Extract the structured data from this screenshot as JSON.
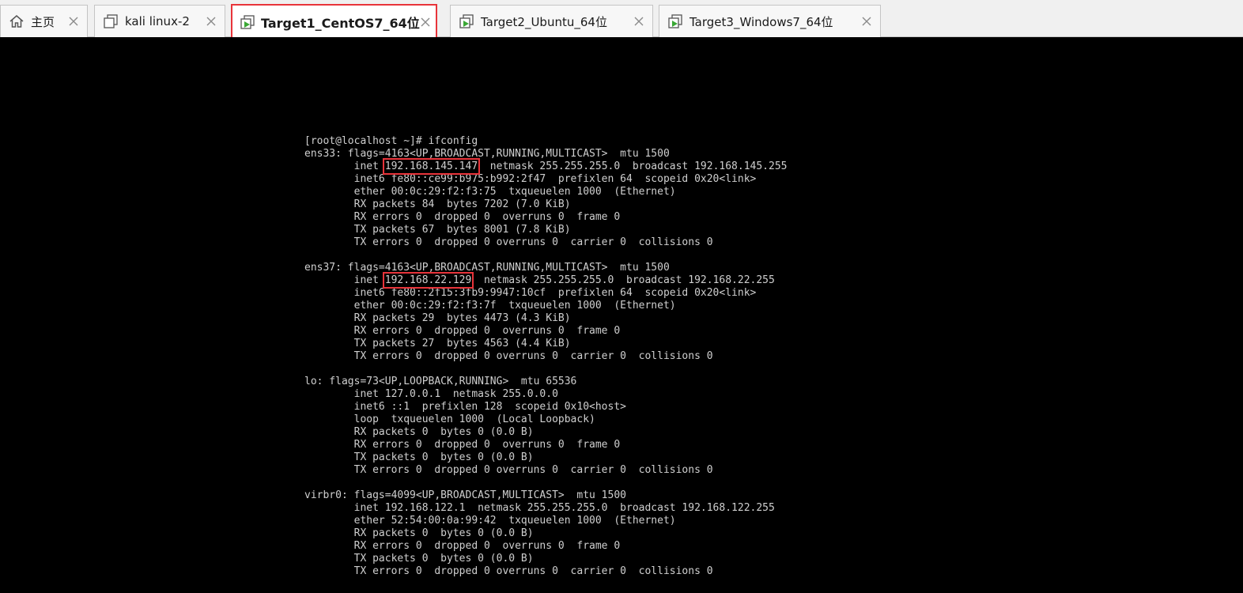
{
  "tabs": [
    {
      "label": "主页",
      "icon": "home-icon"
    },
    {
      "label": "kali linux-2",
      "icon": "vm-icon"
    },
    {
      "label": "Target1_CentOS7_64位",
      "icon": "vm-running-icon",
      "active": true
    },
    {
      "label": "Target2_Ubuntu_64位",
      "icon": "vm-running-icon"
    },
    {
      "label": "Target3_Windows7_64位",
      "icon": "vm-running-icon"
    }
  ],
  "colors": {
    "highlight": "#e8343a",
    "running": "#3aa835",
    "terminal_bg": "#000000",
    "terminal_fg": "#cfcfcf"
  },
  "terminal": {
    "lines": [
      "[root@localhost ~]# ifconfig",
      "ens33: flags=4163<UP,BROADCAST,RUNNING,MULTICAST>  mtu 1500",
      {
        "pre": "        inet ",
        "hl": "192.168.145.147",
        "post": "  netmask 255.255.255.0  broadcast 192.168.145.255"
      },
      "        inet6 fe80::ce99:b975:b992:2f47  prefixlen 64  scopeid 0x20<link>",
      "        ether 00:0c:29:f2:f3:75  txqueuelen 1000  (Ethernet)",
      "        RX packets 84  bytes 7202 (7.0 KiB)",
      "        RX errors 0  dropped 0  overruns 0  frame 0",
      "        TX packets 67  bytes 8001 (7.8 KiB)",
      "        TX errors 0  dropped 0 overruns 0  carrier 0  collisions 0",
      "",
      "ens37: flags=4163<UP,BROADCAST,RUNNING,MULTICAST>  mtu 1500",
      {
        "pre": "        inet ",
        "hl": "192.168.22.129",
        "post": "  netmask 255.255.255.0  broadcast 192.168.22.255"
      },
      "        inet6 fe80::2f15:3fb9:9947:10cf  prefixlen 64  scopeid 0x20<link>",
      "        ether 00:0c:29:f2:f3:7f  txqueuelen 1000  (Ethernet)",
      "        RX packets 29  bytes 4473 (4.3 KiB)",
      "        RX errors 0  dropped 0  overruns 0  frame 0",
      "        TX packets 27  bytes 4563 (4.4 KiB)",
      "        TX errors 0  dropped 0 overruns 0  carrier 0  collisions 0",
      "",
      "lo: flags=73<UP,LOOPBACK,RUNNING>  mtu 65536",
      "        inet 127.0.0.1  netmask 255.0.0.0",
      "        inet6 ::1  prefixlen 128  scopeid 0x10<host>",
      "        loop  txqueuelen 1000  (Local Loopback)",
      "        RX packets 0  bytes 0 (0.0 B)",
      "        RX errors 0  dropped 0  overruns 0  frame 0",
      "        TX packets 0  bytes 0 (0.0 B)",
      "        TX errors 0  dropped 0 overruns 0  carrier 0  collisions 0",
      "",
      "virbr0: flags=4099<UP,BROADCAST,MULTICAST>  mtu 1500",
      "        inet 192.168.122.1  netmask 255.255.255.0  broadcast 192.168.122.255",
      "        ether 52:54:00:0a:99:42  txqueuelen 1000  (Ethernet)",
      "        RX packets 0  bytes 0 (0.0 B)",
      "        RX errors 0  dropped 0  overruns 0  frame 0",
      "        TX packets 0  bytes 0 (0.0 B)",
      "        TX errors 0  dropped 0 overruns 0  carrier 0  collisions 0"
    ]
  }
}
